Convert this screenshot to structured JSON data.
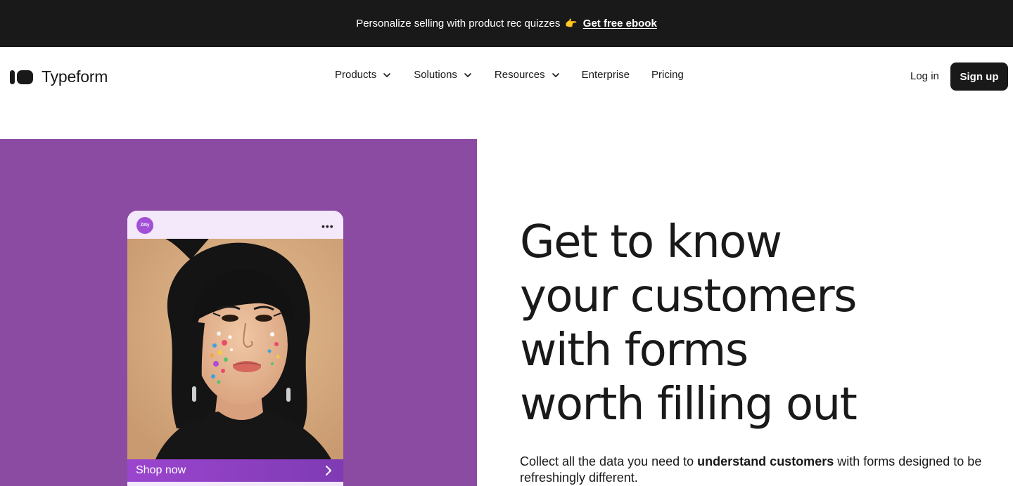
{
  "announcement": {
    "text": "Personalize selling with product rec quizzes",
    "hand_icon": "👉",
    "link_label": "Get free ebook"
  },
  "header": {
    "logo_text": "Typeform",
    "nav": [
      {
        "label": "Products",
        "has_dropdown": true
      },
      {
        "label": "Solutions",
        "has_dropdown": true
      },
      {
        "label": "Resources",
        "has_dropdown": true
      },
      {
        "label": "Enterprise",
        "has_dropdown": false
      },
      {
        "label": "Pricing",
        "has_dropdown": false
      }
    ],
    "login_label": "Log in",
    "signup_label": "Sign up"
  },
  "hero": {
    "panel_color": "#8b4ba3",
    "phone": {
      "brand_badge": "Zitty",
      "more_icon": "more-horizontal-icon",
      "cta_label": "Shop now"
    },
    "headline_lines": [
      "Get to know",
      "your customers",
      "with forms",
      "worth filling out"
    ],
    "subtext_before": "Collect all the data you need to ",
    "subtext_bold": "understand customers",
    "subtext_after": " with forms designed to be refreshingly different."
  }
}
